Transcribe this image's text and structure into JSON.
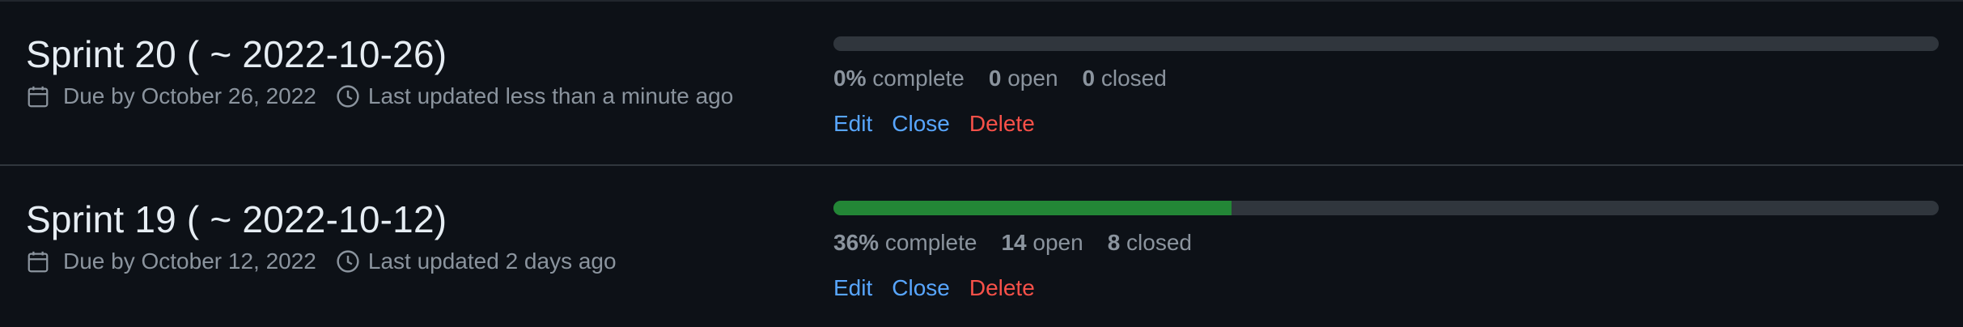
{
  "milestones": [
    {
      "title": "Sprint 20 ( ~ 2022-10-26)",
      "due": "Due by October 26, 2022",
      "updated": "Last updated less than a minute ago",
      "percent": "0%",
      "percent_value": 0,
      "complete_label": "complete",
      "open_count": "0",
      "open_label": "open",
      "closed_count": "0",
      "closed_label": "closed",
      "actions": {
        "edit": "Edit",
        "close": "Close",
        "delete": "Delete"
      }
    },
    {
      "title": "Sprint 19 ( ~ 2022-10-12)",
      "due": "Due by October 12, 2022",
      "updated": "Last updated 2 days ago",
      "percent": "36%",
      "percent_value": 36,
      "complete_label": "complete",
      "open_count": "14",
      "open_label": "open",
      "closed_count": "8",
      "closed_label": "closed",
      "actions": {
        "edit": "Edit",
        "close": "Close",
        "delete": "Delete"
      }
    }
  ],
  "icons": {
    "due": "calendar-icon",
    "updated": "clock-icon"
  },
  "colors": {
    "background": "#0d1117",
    "progress_track": "#30363d",
    "progress_fill": "#238636",
    "link": "#58a6ff",
    "danger": "#f85149",
    "muted": "#8b949e"
  }
}
